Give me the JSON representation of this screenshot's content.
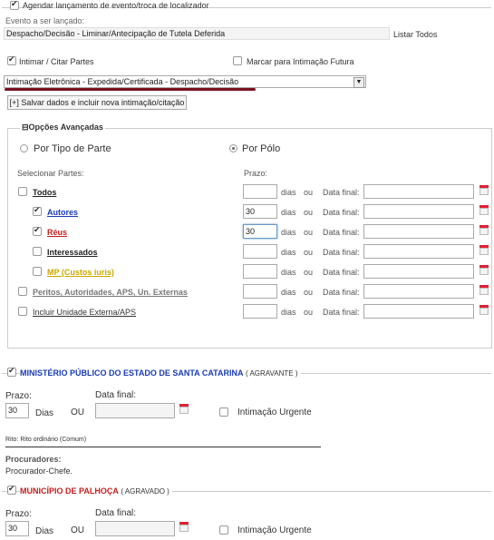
{
  "header": {
    "schedule_label": "Agendar lançamento de evento/troca de localizador"
  },
  "evento": {
    "label": "Evento a ser lançado:",
    "value": "Despacho/Decisão - Liminar/Antecipação de Tutela Deferida",
    "listar_todos": "Listar Todos"
  },
  "options": {
    "intimar_label": "Intimar / Citar Partes",
    "marcar_label": "Marcar para Intimação Futura"
  },
  "intimacao_select": {
    "value": "Intimação Eletrônica - Expedida/Certificada - Despacho/Decisão"
  },
  "save_button": "[+] Salvar dados e incluir nova intimação/citação",
  "advanced": {
    "legend": "Opções Avançadas",
    "legend_toggle": "⊟",
    "por_tipo": "Por Tipo de Parte",
    "por_polo": "Por Pólo",
    "selecionar_label": "Selecionar Partes:",
    "prazo_label": "Prazo:",
    "dias": "dias",
    "ou": "ou",
    "data_final": "Data final:",
    "rows": [
      {
        "label": "Todos",
        "checked": false,
        "prazo": ""
      },
      {
        "label": "Autores",
        "checked": true,
        "prazo": "30"
      },
      {
        "label": "Réus",
        "checked": true,
        "prazo": "30"
      },
      {
        "label": "Interessados",
        "checked": false,
        "prazo": ""
      },
      {
        "label": "MP (Custos iuris)",
        "checked": false,
        "prazo": ""
      },
      {
        "label": "Peritos, Autoridades, APS, Un. Externas",
        "checked": false,
        "prazo": ""
      },
      {
        "label": "Incluir Unidade Externa/APS",
        "checked": false,
        "prazo": ""
      }
    ]
  },
  "party1": {
    "name": "MINISTÉRIO PÚBLICO DO ESTADO DE SANTA CATARINA",
    "role": "( AGRAVANTE )",
    "prazo_label": "Prazo:",
    "prazo": "30",
    "dias": "Dias",
    "ou": "OU",
    "data_final_label": "Data final:",
    "urgente": "Intimação Urgente",
    "rito": "Rito: Rito ordinário (Comum)",
    "procuradores_label": "Procuradores:",
    "procurador": "Procurador-Chefe."
  },
  "party2": {
    "name": "MUNICÍPIO DE PALHOÇA",
    "role": "( AGRAVADO )",
    "prazo_label": "Prazo:",
    "prazo": "30",
    "dias": "Dias",
    "ou": "OU",
    "data_final_label": "Data final:",
    "urgente": "Intimação Urgente"
  },
  "colors": {
    "autores_link": "#1a3bb3",
    "reus_link": "#c02020",
    "mp_link": "#c8a800",
    "party1_name": "#1a3bb3",
    "party2_name": "#c02020",
    "underline_bar": "#7a1020"
  }
}
